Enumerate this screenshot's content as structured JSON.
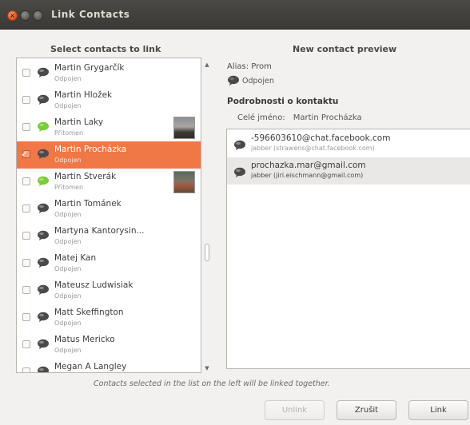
{
  "window": {
    "title": "Link Contacts"
  },
  "left": {
    "heading": "Select contacts to link",
    "contacts": [
      {
        "name": "Martin Grygarčík",
        "status": "Odpojen",
        "presence": "offline",
        "checked": false,
        "selected": false
      },
      {
        "name": "Martin Hložek",
        "status": "Odpojen",
        "presence": "offline",
        "checked": false,
        "selected": false
      },
      {
        "name": "Martin Laky",
        "status": "Přítomen",
        "presence": "online",
        "checked": false,
        "selected": false,
        "avatar": true
      },
      {
        "name": "Martin Procházka",
        "status": "Odpojen",
        "presence": "offline",
        "checked": true,
        "selected": true
      },
      {
        "name": "Martin Stverák",
        "status": "Přítomen",
        "presence": "online",
        "checked": false,
        "selected": false,
        "avatar": true
      },
      {
        "name": "Martin Tománek",
        "status": "Odpojen",
        "presence": "offline",
        "checked": false,
        "selected": false
      },
      {
        "name": "Martyna Kantorysin...",
        "status": "Odpojen",
        "presence": "offline",
        "checked": false,
        "selected": false
      },
      {
        "name": "Matej Kan",
        "status": "Odpojen",
        "presence": "offline",
        "checked": false,
        "selected": false
      },
      {
        "name": "Mateusz Ludwisiak",
        "status": "Odpojen",
        "presence": "offline",
        "checked": false,
        "selected": false
      },
      {
        "name": "Matt Skeffington",
        "status": "Odpojen",
        "presence": "offline",
        "checked": false,
        "selected": false
      },
      {
        "name": "Matus Mericko",
        "status": "Odpojen",
        "presence": "offline",
        "checked": false,
        "selected": false
      },
      {
        "name": "Megan A Langley",
        "status": "",
        "presence": "offline",
        "checked": false,
        "selected": false
      }
    ]
  },
  "right": {
    "heading": "New contact preview",
    "alias": "Alias: Prom",
    "status": "Odpojen",
    "section_title": "Podrobnosti o kontaktu",
    "fullname_label": "Celé jméno:",
    "fullname_value": "Martin Procházka",
    "accounts": [
      {
        "id": "-596603610@chat.facebook.com",
        "sub": "jabber (strawens@chat.facebook.com)",
        "selected": false
      },
      {
        "id": "prochazka.mar@gmail.com",
        "sub": "jabber (jiri.eischmann@gmail.com)",
        "selected": true
      }
    ]
  },
  "footer": {
    "note": "Contacts selected in the list on the left will be linked together.",
    "unlink_label": "Unlink",
    "cancel_label": "Zrušit",
    "link_label": "Link"
  },
  "colors": {
    "selection": "#f07746",
    "presence_online": "#7ccb3a",
    "presence_offline": "#4a4a4a",
    "titlebar": "#3c3b37"
  }
}
